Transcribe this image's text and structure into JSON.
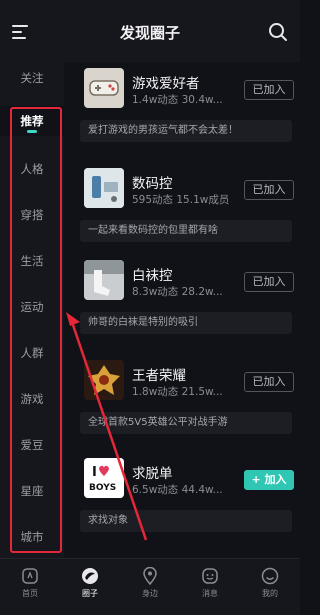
{
  "header": {
    "title": "发现圈子"
  },
  "sidebar": {
    "items": [
      {
        "label": "关注"
      },
      {
        "label": "推荐"
      },
      {
        "label": "人格"
      },
      {
        "label": "穿搭"
      },
      {
        "label": "生活"
      },
      {
        "label": "运动"
      },
      {
        "label": "人群"
      },
      {
        "label": "游戏"
      },
      {
        "label": "爱豆"
      },
      {
        "label": "星座"
      },
      {
        "label": "城市"
      }
    ],
    "active": "推荐"
  },
  "circles": [
    {
      "name": "游戏爱好者",
      "stats": "1.4w动态 30.4w...",
      "button": "已加入",
      "desc": "爱打游戏的男孩运气都不会太差！",
      "icon": "gamepad-thumbnail"
    },
    {
      "name": "数码控",
      "stats": "595动态 15.1w成员",
      "button": "已加入",
      "desc": "一起来看数码控的包里都有啥",
      "icon": "gadget-thumbnail"
    },
    {
      "name": "白袜控",
      "stats": "8.3w动态 28.2w...",
      "button": "已加入",
      "desc": "帅哥的白袜是特别的吸引",
      "icon": "socks-thumbnail"
    },
    {
      "name": "王者荣耀",
      "stats": "1.8w动态 21.5w...",
      "button": "已加入",
      "desc": "全球首款5V5英雄公平对战手游",
      "icon": "game-logo-thumbnail"
    },
    {
      "name": "求脱单",
      "stats": "6.5w动态 44.4w...",
      "button": "+ 加入",
      "desc": "求找对象",
      "icon": "love-boys-thumbnail",
      "thumb_text": "I",
      "thumb_text2": "BOYS"
    }
  ],
  "tabbar": {
    "items": [
      {
        "label": "首页",
        "icon": "home-icon"
      },
      {
        "label": "圈子",
        "icon": "circle-icon"
      },
      {
        "label": "身边",
        "icon": "location-icon"
      },
      {
        "label": "消息",
        "icon": "message-icon"
      },
      {
        "label": "我的",
        "icon": "profile-icon"
      }
    ],
    "active": "圈子"
  },
  "colors": {
    "accent": "#2fc7b3",
    "highlight": "#e5273a",
    "background": "#111217"
  }
}
